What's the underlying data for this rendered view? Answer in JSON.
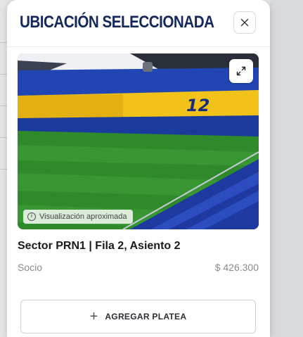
{
  "modal": {
    "title": "UBICACIÓN SELECCIONADA",
    "close_icon": "close-icon",
    "expand_icon": "expand-icon"
  },
  "image": {
    "badge_text": "Visualización aproximada",
    "badge_icon": "info-icon"
  },
  "seat": {
    "title": "Sector PRN1 | Fila 2, Asiento 2",
    "category": "Socio",
    "price": "$ 426.300"
  },
  "actions": {
    "add_label": "AGREGAR PLATEA",
    "add_icon": "plus-icon"
  },
  "colors": {
    "title": "#15275c",
    "stands_blue": "#1f3fa8",
    "stands_yellow": "#f1c21b",
    "pitch": "#2f8a2c"
  }
}
